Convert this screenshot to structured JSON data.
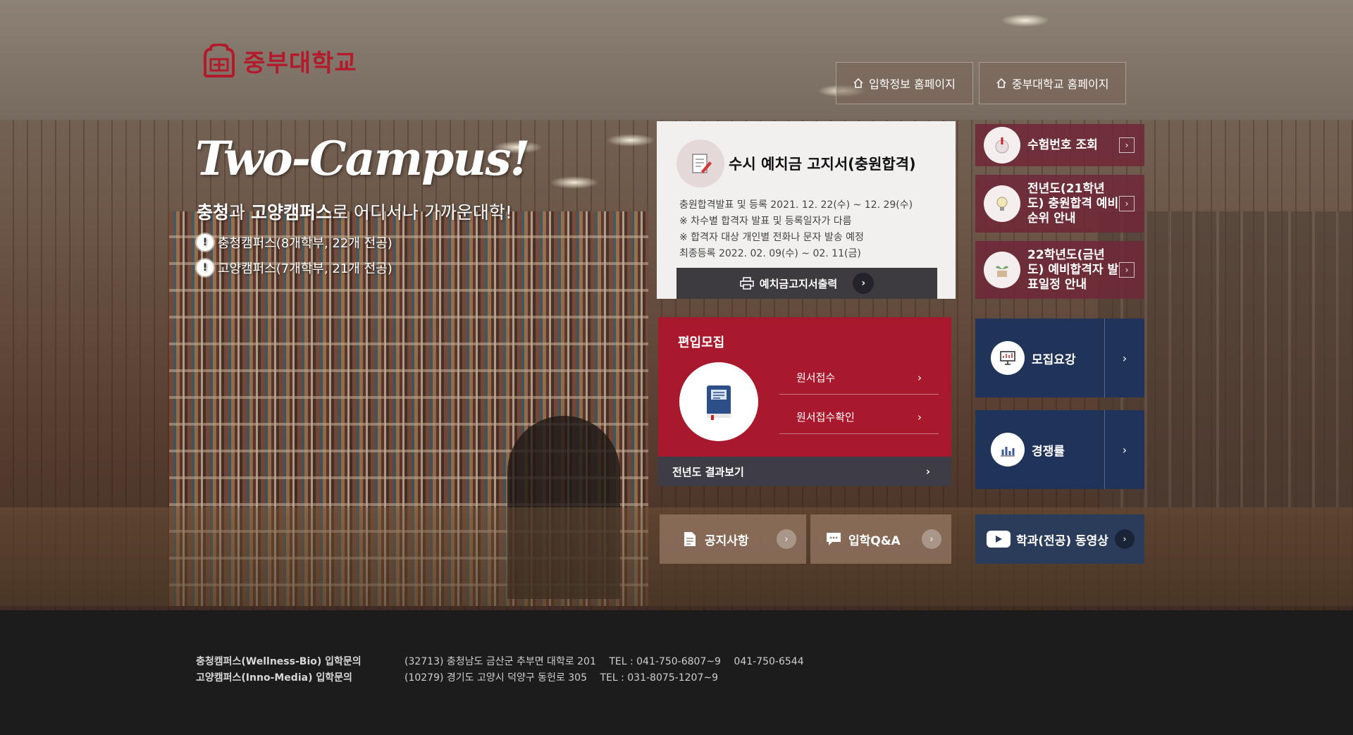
{
  "header": {
    "logo_text": "중부대학교",
    "links": [
      {
        "label": "입학정보 홈페이지"
      },
      {
        "label": "중부대학교 홈페이지"
      }
    ]
  },
  "hero": {
    "script_title": "Two-Campus!",
    "subtitle_strong1": "충청",
    "subtitle_mid": "과 ",
    "subtitle_strong2": "고양캠퍼스",
    "subtitle_rest": "로 어디서나 가까운대학!",
    "campus_lines": [
      {
        "text": "충청캠퍼스(8개학부, 22개 전공)"
      },
      {
        "text": "고양캠퍼스(7개학부, 21개 전공)"
      }
    ]
  },
  "notice": {
    "title": "수시 예치금 고지서(충원합격)",
    "lines": [
      "충원합격발표 및 등록  2021. 12. 22(수) ~ 12. 29(수)",
      "※ 차수별 합격자 발표 및 등록일자가 다름",
      "※ 합격자 대상 개인별 전화나 문자 발송 예정",
      "최종등록  2022. 02. 09(수) ~ 02. 11(금)"
    ],
    "button_label": "예치금고지서출력"
  },
  "right_tiles": [
    {
      "label": "수험번호 조회"
    },
    {
      "label": "전년도(21학년도) 충원합격 예비순위 안내"
    },
    {
      "label": "22학년도(금년도) 예비합격자 발표일정 안내"
    }
  ],
  "transfer": {
    "title": "편입모집",
    "links": [
      {
        "label": "원서접수"
      },
      {
        "label": "원서접수확인"
      }
    ],
    "prev_result": "전년도 결과보기"
  },
  "navy_tiles": [
    {
      "label": "모집요강"
    },
    {
      "label": "경쟁률"
    }
  ],
  "bottom_tiles": [
    {
      "label": "공지사항"
    },
    {
      "label": "입학Q&A"
    },
    {
      "label": "학과(전공) 동영상"
    }
  ],
  "footer": {
    "left": [
      "충청캠퍼스(Wellness-Bio) 입학문의",
      "고양캠퍼스(Inno-Media) 입학문의"
    ],
    "rows": [
      {
        "address": "(32713) 충청남도 금산군 추부면 대학로 201",
        "tel": "TEL : 041-750-6807~9",
        "fax": "041-750-6544"
      },
      {
        "address": "(10279) 경기도 고양시 덕양구 동헌로 305",
        "tel": "TEL : 031-8075-1207~9",
        "fax": ""
      }
    ]
  },
  "colors": {
    "brand_red": "#a8192e",
    "navy": "#20345a",
    "footer_bg": "#1c1c1c"
  }
}
